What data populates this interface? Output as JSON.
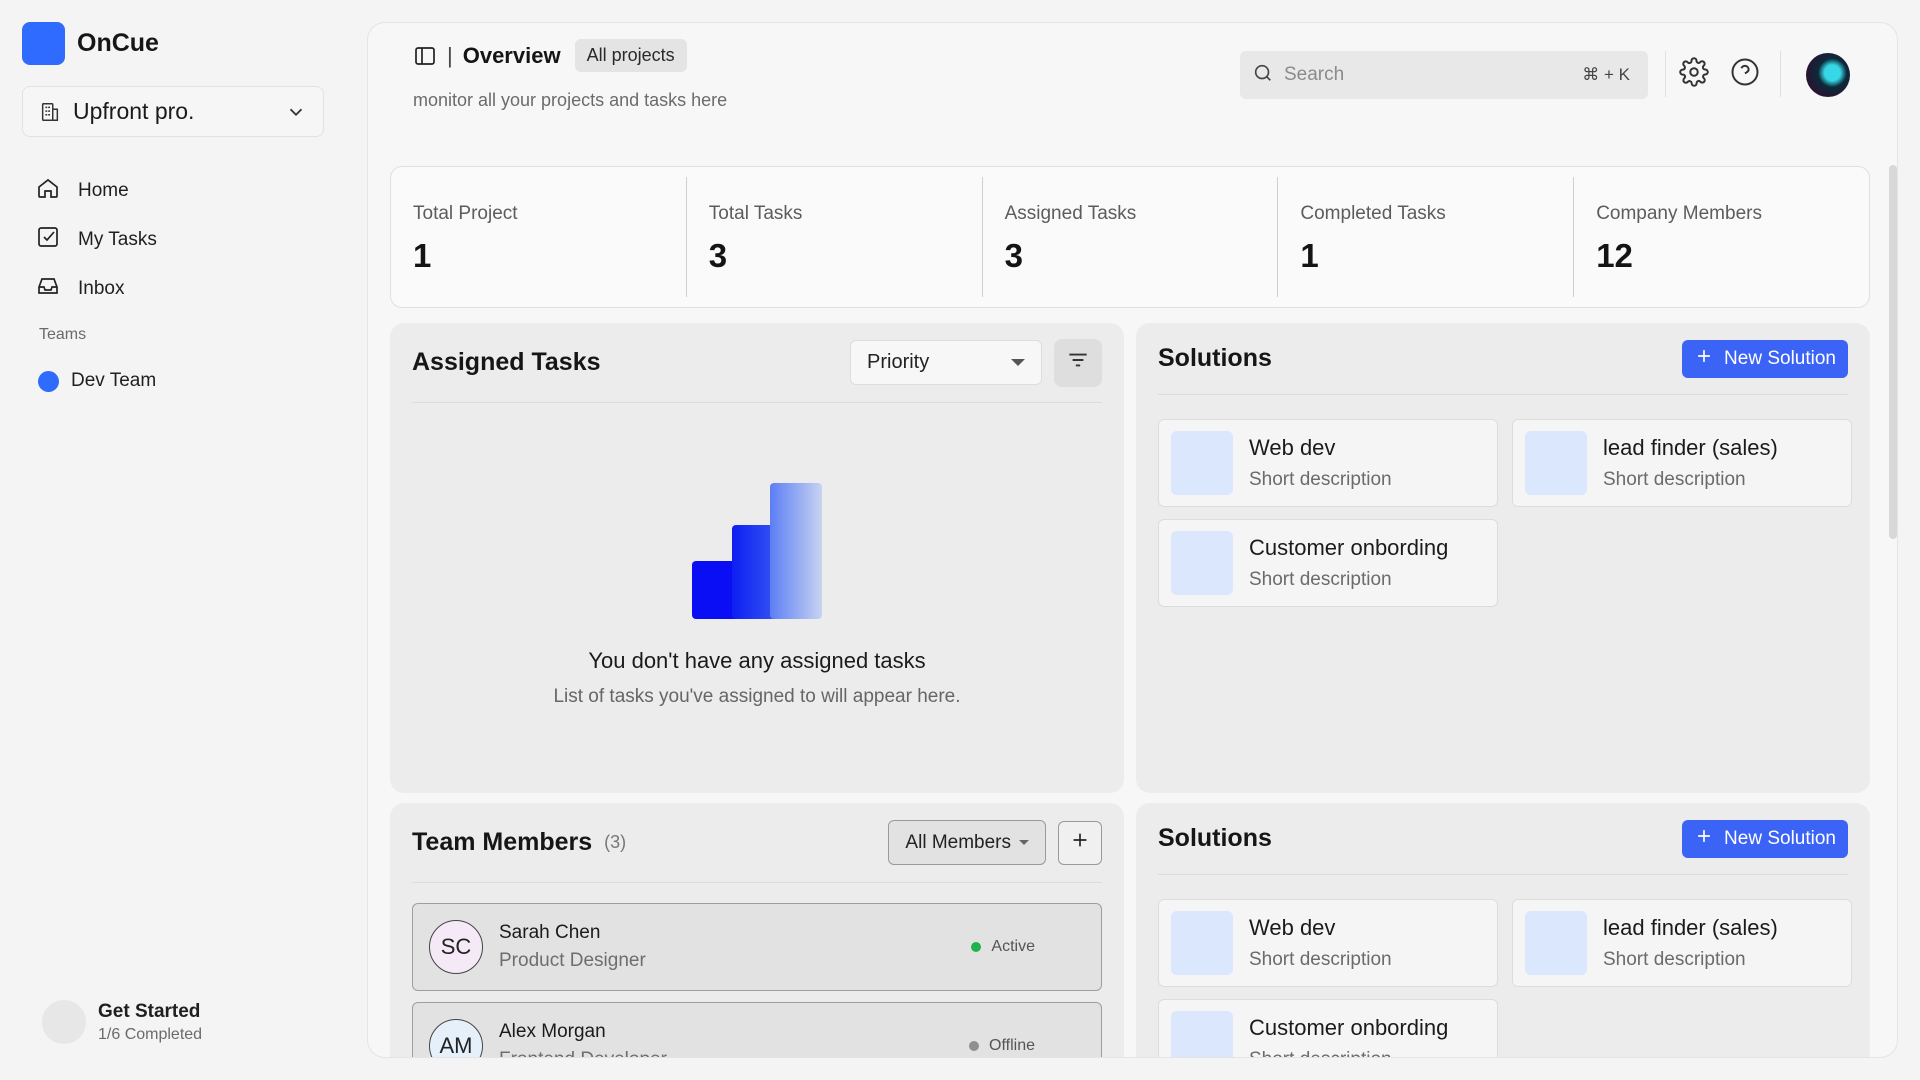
{
  "app": {
    "name": "OnCue"
  },
  "workspace": {
    "name": "Upfront pro."
  },
  "nav": [
    {
      "label": "Home",
      "icon": "home-icon"
    },
    {
      "label": "My Tasks",
      "icon": "checkbox-icon"
    },
    {
      "label": "Inbox",
      "icon": "inbox-icon"
    }
  ],
  "teams": {
    "label": "Teams",
    "items": [
      {
        "label": "Dev Team",
        "color": "#2f6bff"
      }
    ]
  },
  "get_started": {
    "title": "Get Started",
    "progress_text": "1/6 Completed",
    "progress_fraction": 0.1667
  },
  "header": {
    "title": "Overview",
    "chip": "All projects",
    "subtitle": "monitor all your projects and tasks here",
    "search": {
      "placeholder": "Search",
      "shortcut": "⌘ + K"
    }
  },
  "stats": [
    {
      "label": "Total Project",
      "value": "1"
    },
    {
      "label": "Total Tasks",
      "value": "3"
    },
    {
      "label": "Assigned Tasks",
      "value": "3"
    },
    {
      "label": "Completed Tasks",
      "value": "1"
    },
    {
      "label": "Company Members",
      "value": "12"
    }
  ],
  "assigned_tasks": {
    "title": "Assigned Tasks",
    "sort": {
      "selected": "Priority"
    },
    "empty_title": "You don't have any assigned tasks",
    "empty_sub": "List of tasks you've assigned to will appear here."
  },
  "solutions": {
    "title": "Solutions",
    "button": "New Solution",
    "items": [
      {
        "name": "Web dev",
        "desc": "Short description"
      },
      {
        "name": "lead finder (sales)",
        "desc": "Short description"
      },
      {
        "name": "Customer onbording",
        "desc": "Short description"
      }
    ]
  },
  "team_members": {
    "title": "Team Members",
    "count": "(3)",
    "filter": "All Members",
    "members": [
      {
        "initials": "SC",
        "name": "Sarah Chen",
        "role": "Product Designer",
        "status": "Active",
        "status_color": "#22b24c",
        "avatar_bg": "#f5e9f7"
      },
      {
        "initials": "AM",
        "name": "Alex Morgan",
        "role": "Frontend Developer",
        "status": "Offline",
        "status_color": "#8f8f8f",
        "avatar_bg": "#e6f0fb"
      }
    ]
  },
  "colors": {
    "accent": "#2f6bff",
    "button": "#3b63f5"
  }
}
